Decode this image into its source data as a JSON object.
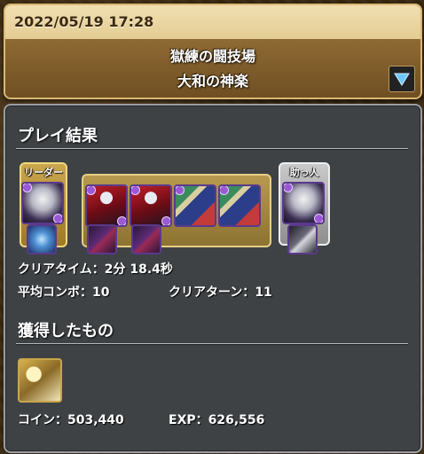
{
  "header": {
    "timestamp": "2022/05/19 17:28",
    "dungeon_title": "獄練の闘技場",
    "dungeon_floor": "大和の神楽"
  },
  "result": {
    "section_title": "プレイ結果",
    "leader_label": "リーダー",
    "helper_label": "助っ人",
    "clear_time_label": "クリアタイム：",
    "clear_time_value": "2分 18.4秒",
    "avg_combo_label": "平均コンボ：",
    "avg_combo_value": "10",
    "clear_turn_label": "クリアターン：",
    "clear_turn_value": "11"
  },
  "rewards": {
    "section_title": "獲得したもの",
    "coin_label": "コイン：",
    "coin_value": "503,440",
    "exp_label": "EXP：",
    "exp_value": "626,556"
  },
  "icons": {
    "expand": "triangle-down-icon"
  },
  "colors": {
    "panel_bg": "#3f4245",
    "leader_frame": "#caa64d",
    "helper_frame": "#c9c9c9",
    "expand_arrow": "#6ec6ff"
  }
}
